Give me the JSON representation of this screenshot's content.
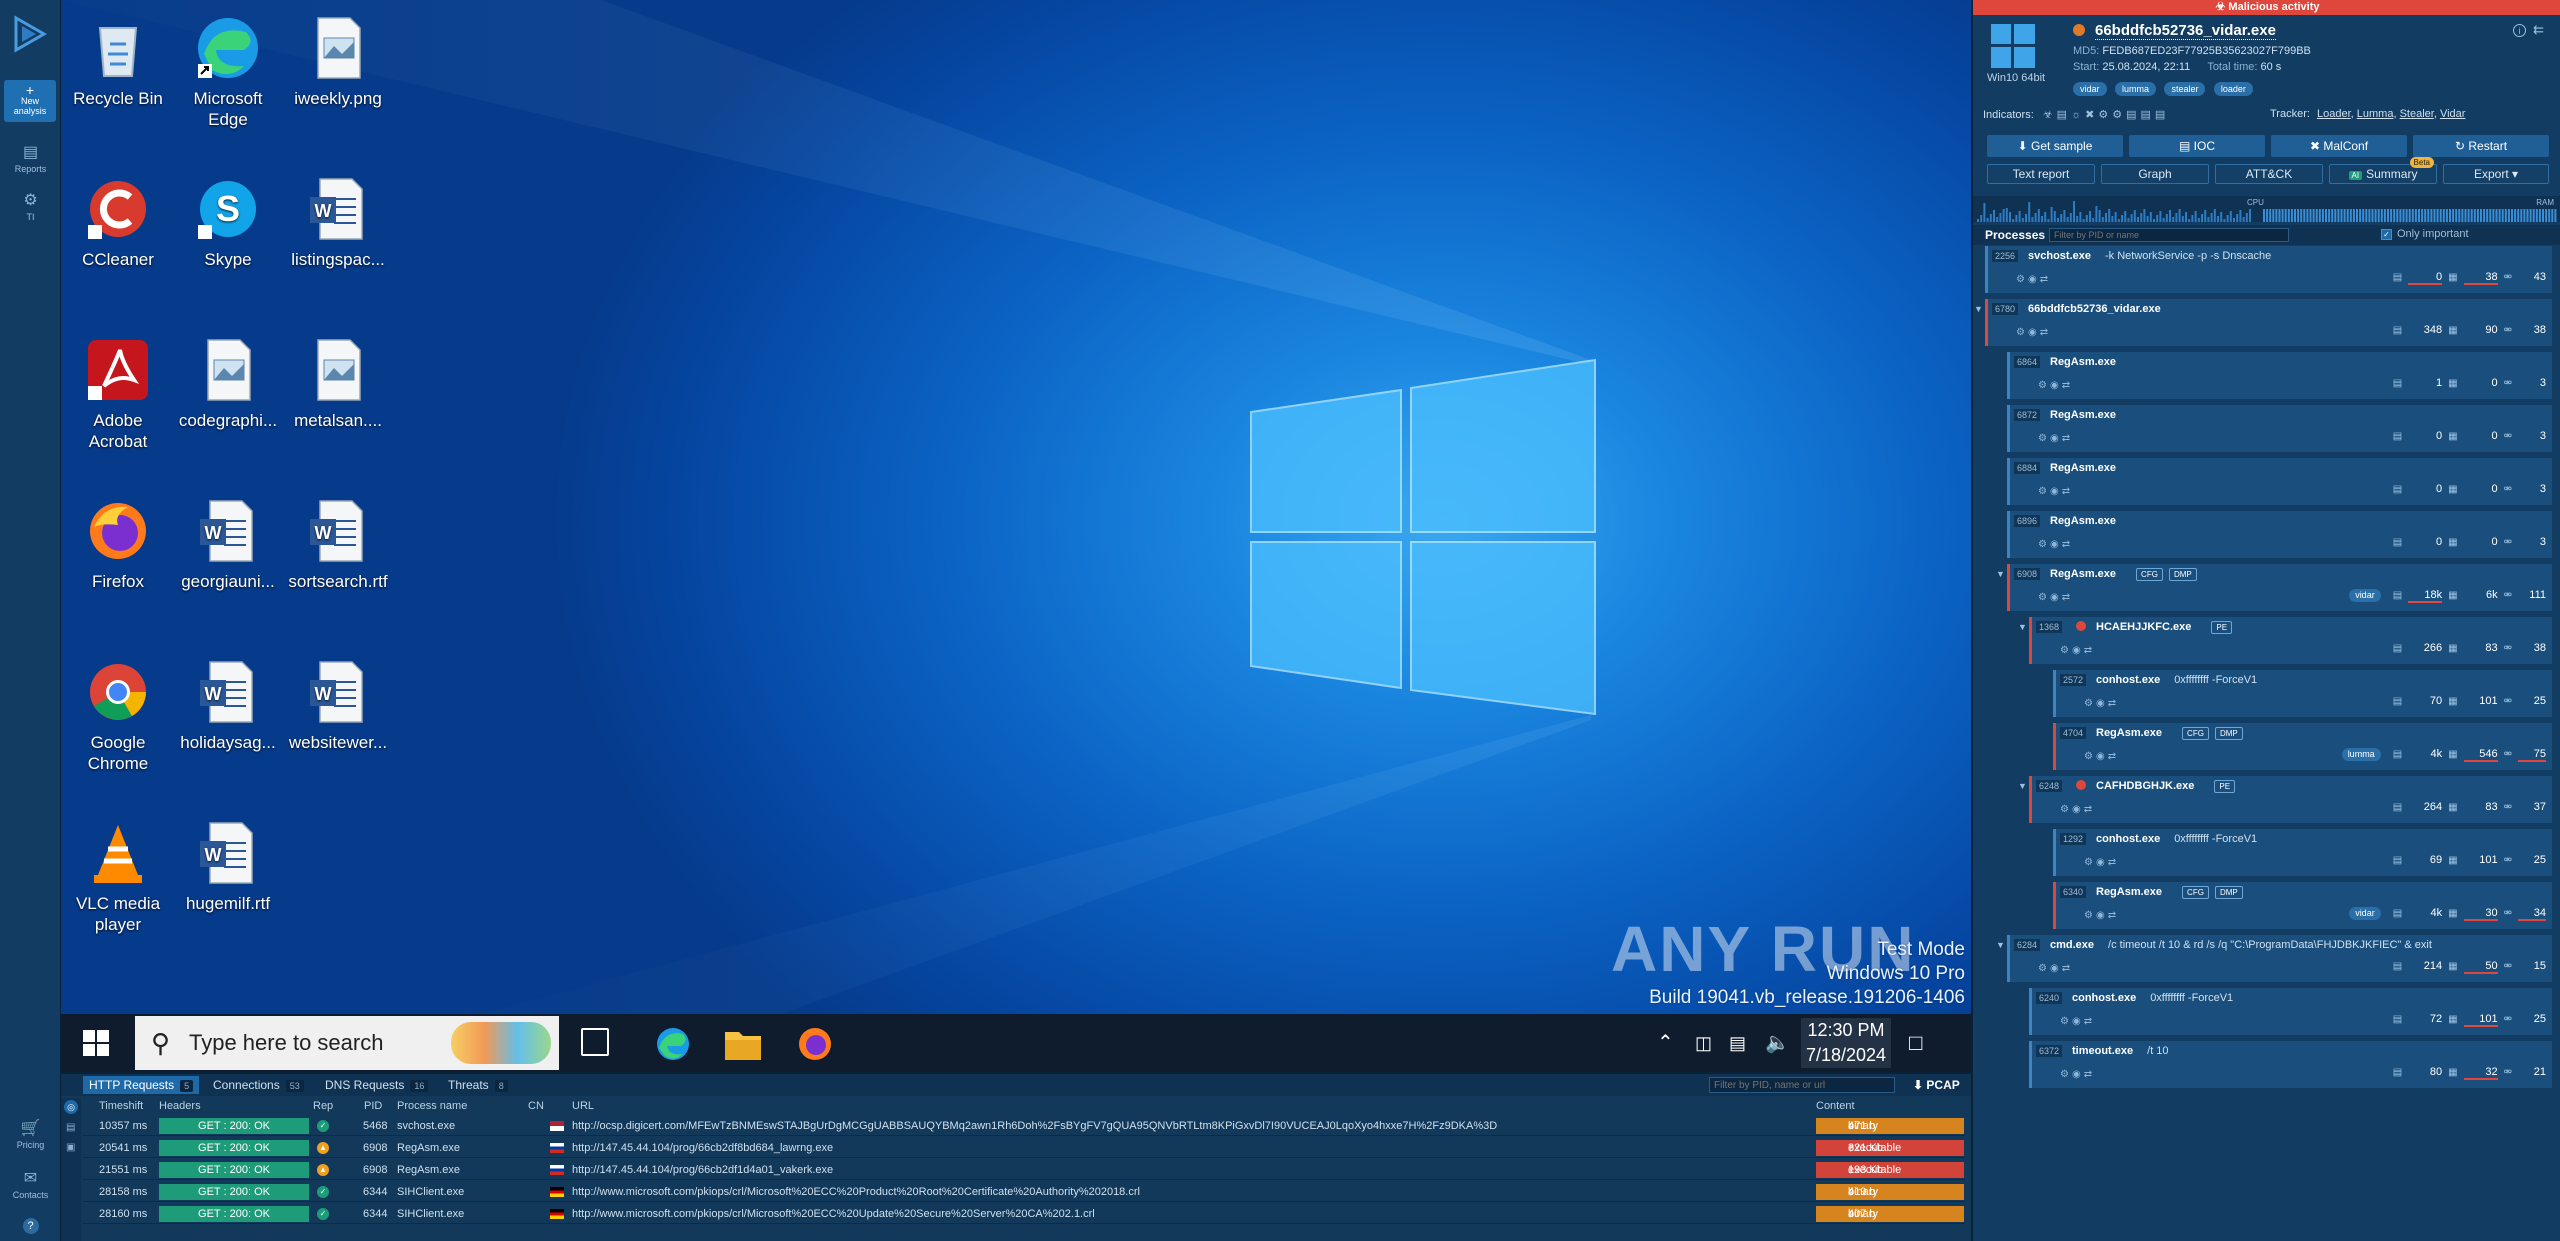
{
  "rail": {
    "new_label": "New analysis",
    "reports_label": "Reports",
    "ti_label": "TI",
    "pricing_label": "Pricing",
    "contacts_label": "Contacts"
  },
  "desktop": {
    "icons": [
      {
        "label": "Recycle Bin",
        "icon": "recycle-bin-icon"
      },
      {
        "label": "Microsoft Edge",
        "icon": "edge-icon"
      },
      {
        "label": "iweekly.png",
        "icon": "image-file-icon"
      },
      {
        "label": "CCleaner",
        "icon": "ccleaner-icon"
      },
      {
        "label": "Skype",
        "icon": "skype-icon"
      },
      {
        "label": "listingspac...",
        "icon": "word-doc-icon"
      },
      {
        "label": "Adobe Acrobat",
        "icon": "acrobat-icon"
      },
      {
        "label": "codegraphi...",
        "icon": "image-file-icon"
      },
      {
        "label": "metalsan....",
        "icon": "image-file-icon"
      },
      {
        "label": "Firefox",
        "icon": "firefox-icon"
      },
      {
        "label": "georgiauni...",
        "icon": "word-doc-icon"
      },
      {
        "label": "sortsearch.rtf",
        "icon": "word-doc-icon"
      },
      {
        "label": "Google Chrome",
        "icon": "chrome-icon"
      },
      {
        "label": "holidaysag...",
        "icon": "word-doc-icon"
      },
      {
        "label": "websitewer...",
        "icon": "word-doc-icon"
      },
      {
        "label": "VLC media player",
        "icon": "vlc-icon"
      },
      {
        "label": "hugemilf.rtf",
        "icon": "word-doc-icon"
      }
    ],
    "watermark_logo": "ANY RUN",
    "watermark_lines": [
      "Test Mode",
      "Windows 10 Pro",
      "Build 19041.vb_release.191206-1406"
    ]
  },
  "taskbar": {
    "search_placeholder": "Type here to search",
    "time": "12:30 PM",
    "date": "7/18/2024"
  },
  "network": {
    "tabs": [
      {
        "label": "HTTP Requests",
        "count": "5"
      },
      {
        "label": "Connections",
        "count": "53"
      },
      {
        "label": "DNS Requests",
        "count": "16"
      },
      {
        "label": "Threats",
        "count": "8"
      }
    ],
    "filter_placeholder": "Filter by PID, name or url",
    "pcap_label": "PCAP",
    "columns": [
      "Timeshift",
      "Headers",
      "Rep",
      "PID",
      "Process name",
      "CN",
      "URL",
      "Content"
    ],
    "rows": [
      {
        "time": "10357 ms",
        "status": "GET : 200: OK",
        "rep": "ok",
        "pid": "5468",
        "proc": "svchost.exe",
        "cn": "US",
        "url": "http://ocsp.digicert.com/MFEwTzBNMEswSTAJBgUrDgMCGgUABBSAUQYBMq2awn1Rh6Doh%2FsBYgFV7gQUA95QNVbRTLtm8KPiGxvDl7I90VUCEAJ0LqoXyo4hxxe7H%2Fz9DKA%3D",
        "size": "471 b",
        "type": "binary",
        "ctype_color": "#d6841e"
      },
      {
        "time": "20541 ms",
        "status": "GET : 200: OK",
        "rep": "warn",
        "pid": "6908",
        "proc": "RegAsm.exe",
        "cn": "RU",
        "url": "http://147.45.44.104/prog/66cb2df8bd684_lawrng.exe",
        "size": "321 Kb",
        "type": "executable",
        "ctype_color": "#d2433a"
      },
      {
        "time": "21551 ms",
        "status": "GET : 200: OK",
        "rep": "warn",
        "pid": "6908",
        "proc": "RegAsm.exe",
        "cn": "RU",
        "url": "http://147.45.44.104/prog/66cb2df1d4a01_vakerk.exe",
        "size": "193 Kb",
        "type": "executable",
        "ctype_color": "#d2433a"
      },
      {
        "time": "28158 ms",
        "status": "GET : 200: OK",
        "rep": "ok",
        "pid": "6344",
        "proc": "SIHClient.exe",
        "cn": "DE",
        "url": "http://www.microsoft.com/pkiops/crl/Microsoft%20ECC%20Product%20Root%20Certificate%20Authority%202018.crl",
        "size": "419 b",
        "type": "binary",
        "ctype_color": "#d6841e"
      },
      {
        "time": "28160 ms",
        "status": "GET : 200: OK",
        "rep": "ok",
        "pid": "6344",
        "proc": "SIHClient.exe",
        "cn": "DE",
        "url": "http://www.microsoft.com/pkiops/crl/Microsoft%20ECC%20Update%20Secure%20Server%20CA%202.1.crl",
        "size": "407 b",
        "type": "binary",
        "ctype_color": "#d6841e"
      }
    ]
  },
  "sidebar": {
    "verdict": "Malicious activity",
    "os_label": "Win10 64bit",
    "filename": "66bddfcb52736_vidar.exe",
    "md5_label": "MD5:",
    "md5": "FEDB687ED23F77925B35623027F799BB",
    "start_label": "Start:",
    "start": "25.08.2024, 22:11",
    "total_time_label": "Total time:",
    "total_time": "60 s",
    "tags": [
      "vidar",
      "lumma",
      "stealer",
      "loader"
    ],
    "indicators_label": "Indicators:",
    "tracker_label": "Tracker:",
    "tracker_links": [
      "Loader",
      "Lumma",
      "Stealer",
      "Vidar"
    ],
    "buttons": [
      "Get sample",
      "IOC",
      "MalConf",
      "Restart"
    ],
    "buttons2": [
      "Text report",
      "Graph",
      "ATT&CK",
      "Summary",
      "Export"
    ],
    "beta_label": "Beta",
    "ai_label": "AI",
    "cpu_label": "CPU",
    "ram_label": "RAM",
    "processes_label": "Processes",
    "filter_placeholder": "Filter by PID or name",
    "only_important": "Only important",
    "processes": [
      {
        "pid": "2256",
        "name": "svchost.exe",
        "args": "-k NetworkService -p -s Dnscache",
        "s1": "0",
        "s2": "38",
        "s3": "43"
      },
      {
        "pid": "6780",
        "name": "66bddfcb52736_vidar.exe",
        "args": "",
        "s1": "348",
        "s2": "90",
        "s3": "38"
      },
      {
        "pid": "6864",
        "name": "RegAsm.exe",
        "args": "",
        "s1": "1",
        "s2": "0",
        "s3": "3"
      },
      {
        "pid": "6872",
        "name": "RegAsm.exe",
        "args": "",
        "s1": "0",
        "s2": "0",
        "s3": "3"
      },
      {
        "pid": "6884",
        "name": "RegAsm.exe",
        "args": "",
        "s1": "0",
        "s2": "0",
        "s3": "3"
      },
      {
        "pid": "6896",
        "name": "RegAsm.exe",
        "args": "",
        "s1": "0",
        "s2": "0",
        "s3": "3"
      },
      {
        "pid": "6908",
        "name": "RegAsm.exe",
        "args": "",
        "badges": [
          "CFG",
          "DMP"
        ],
        "tag": "vidar",
        "s1": "18k",
        "s2": "6k",
        "s3": "111"
      },
      {
        "pid": "1368",
        "name": "HCAEHJJKFC.exe",
        "args": "",
        "badges": [
          "PE"
        ],
        "s1": "266",
        "s2": "83",
        "s3": "38"
      },
      {
        "pid": "2572",
        "name": "conhost.exe",
        "args": "0xffffffff -ForceV1",
        "s1": "70",
        "s2": "101",
        "s3": "25"
      },
      {
        "pid": "4704",
        "name": "RegAsm.exe",
        "args": "",
        "badges": [
          "CFG",
          "DMP"
        ],
        "tag": "lumma",
        "s1": "4k",
        "s2": "546",
        "s3": "75"
      },
      {
        "pid": "6248",
        "name": "CAFHDBGHJK.exe",
        "args": "",
        "badges": [
          "PE"
        ],
        "s1": "264",
        "s2": "83",
        "s3": "37"
      },
      {
        "pid": "1292",
        "name": "conhost.exe",
        "args": "0xffffffff -ForceV1",
        "s1": "69",
        "s2": "101",
        "s3": "25"
      },
      {
        "pid": "6340",
        "name": "RegAsm.exe",
        "args": "",
        "badges": [
          "CFG",
          "DMP"
        ],
        "tag": "vidar",
        "s1": "4k",
        "s2": "30",
        "s3": "34"
      },
      {
        "pid": "6284",
        "name": "cmd.exe",
        "args": "/c timeout /t 10 & rd /s /q \"C:\\ProgramData\\FHJDBKJKFIEC\" & exit",
        "s1": "214",
        "s2": "50",
        "s3": "15"
      },
      {
        "pid": "6240",
        "name": "conhost.exe",
        "args": "0xffffffff -ForceV1",
        "s1": "72",
        "s2": "101",
        "s3": "25"
      },
      {
        "pid": "6372",
        "name": "timeout.exe",
        "args": "/t 10",
        "s1": "80",
        "s2": "32",
        "s3": "21"
      }
    ]
  },
  "colors": {
    "accent": "#1f6fb3",
    "malicious": "#e0473c",
    "ok_status": "#1e9c7a"
  }
}
